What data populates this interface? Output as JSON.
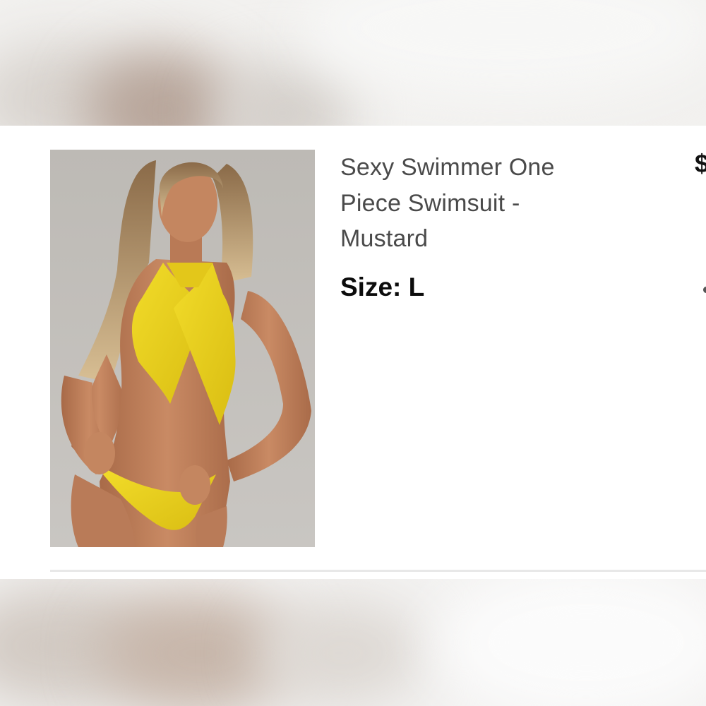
{
  "product": {
    "title": "Sexy Swimmer One Piece Swimsuit - Mustard",
    "size_label": "Size:",
    "size_value": "L",
    "price_partial": "$",
    "image_icon": "product-photo",
    "swimsuit_color": "#efd51f"
  },
  "colors": {
    "background": "#ffffff",
    "title_text": "#4a4a4a",
    "size_text": "#0c0c0c",
    "divider": "#e8e8e8"
  }
}
